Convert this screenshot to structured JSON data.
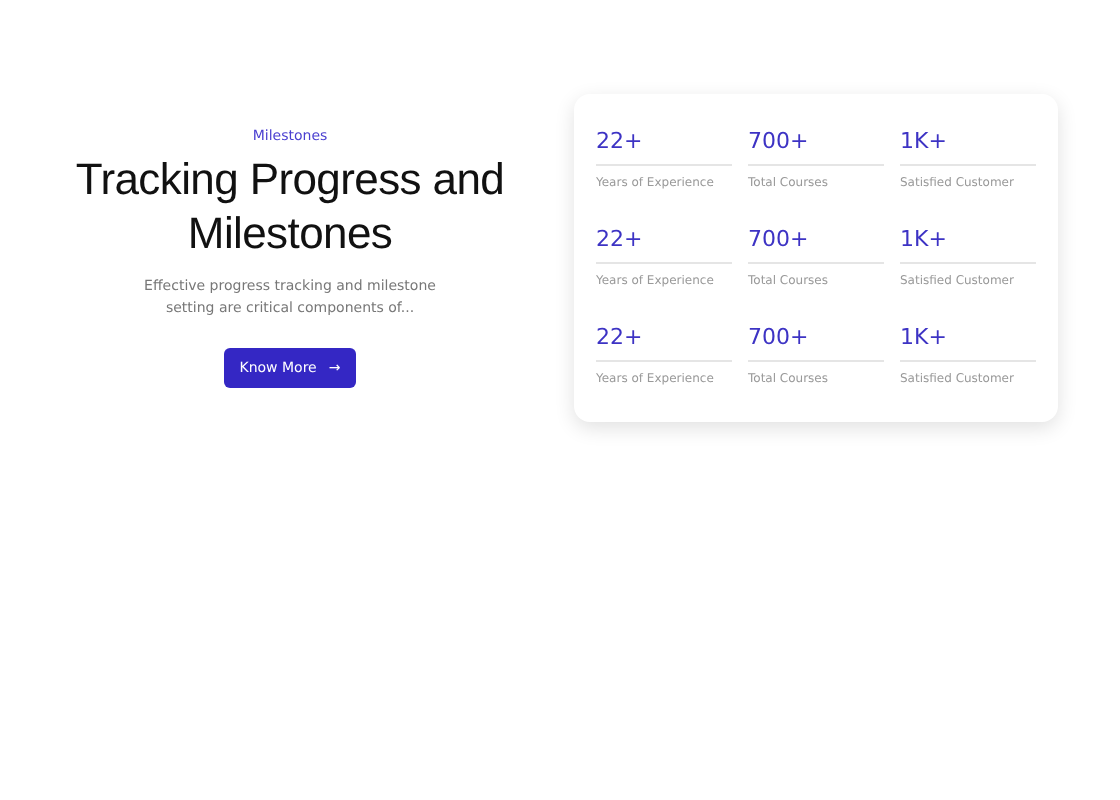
{
  "hero": {
    "eyebrow": "Milestones",
    "title": "Tracking Progress and Milestones",
    "description": "Effective progress tracking and milestone setting are critical components of...",
    "button": {
      "label": "Know More",
      "icon": "→"
    }
  },
  "stats": [
    {
      "value": "22+",
      "label": "Years of Experience"
    },
    {
      "value": "700+",
      "label": "Total Courses"
    },
    {
      "value": "1K+",
      "label": "Satisfied Customer"
    },
    {
      "value": "22+",
      "label": "Years of Experience"
    },
    {
      "value": "700+",
      "label": "Total Courses"
    },
    {
      "value": "1K+",
      "label": "Satisfied Customer"
    },
    {
      "value": "22+",
      "label": "Years of Experience"
    },
    {
      "value": "700+",
      "label": "Total Courses"
    },
    {
      "value": "1K+",
      "label": "Satisfied Customer"
    }
  ]
}
